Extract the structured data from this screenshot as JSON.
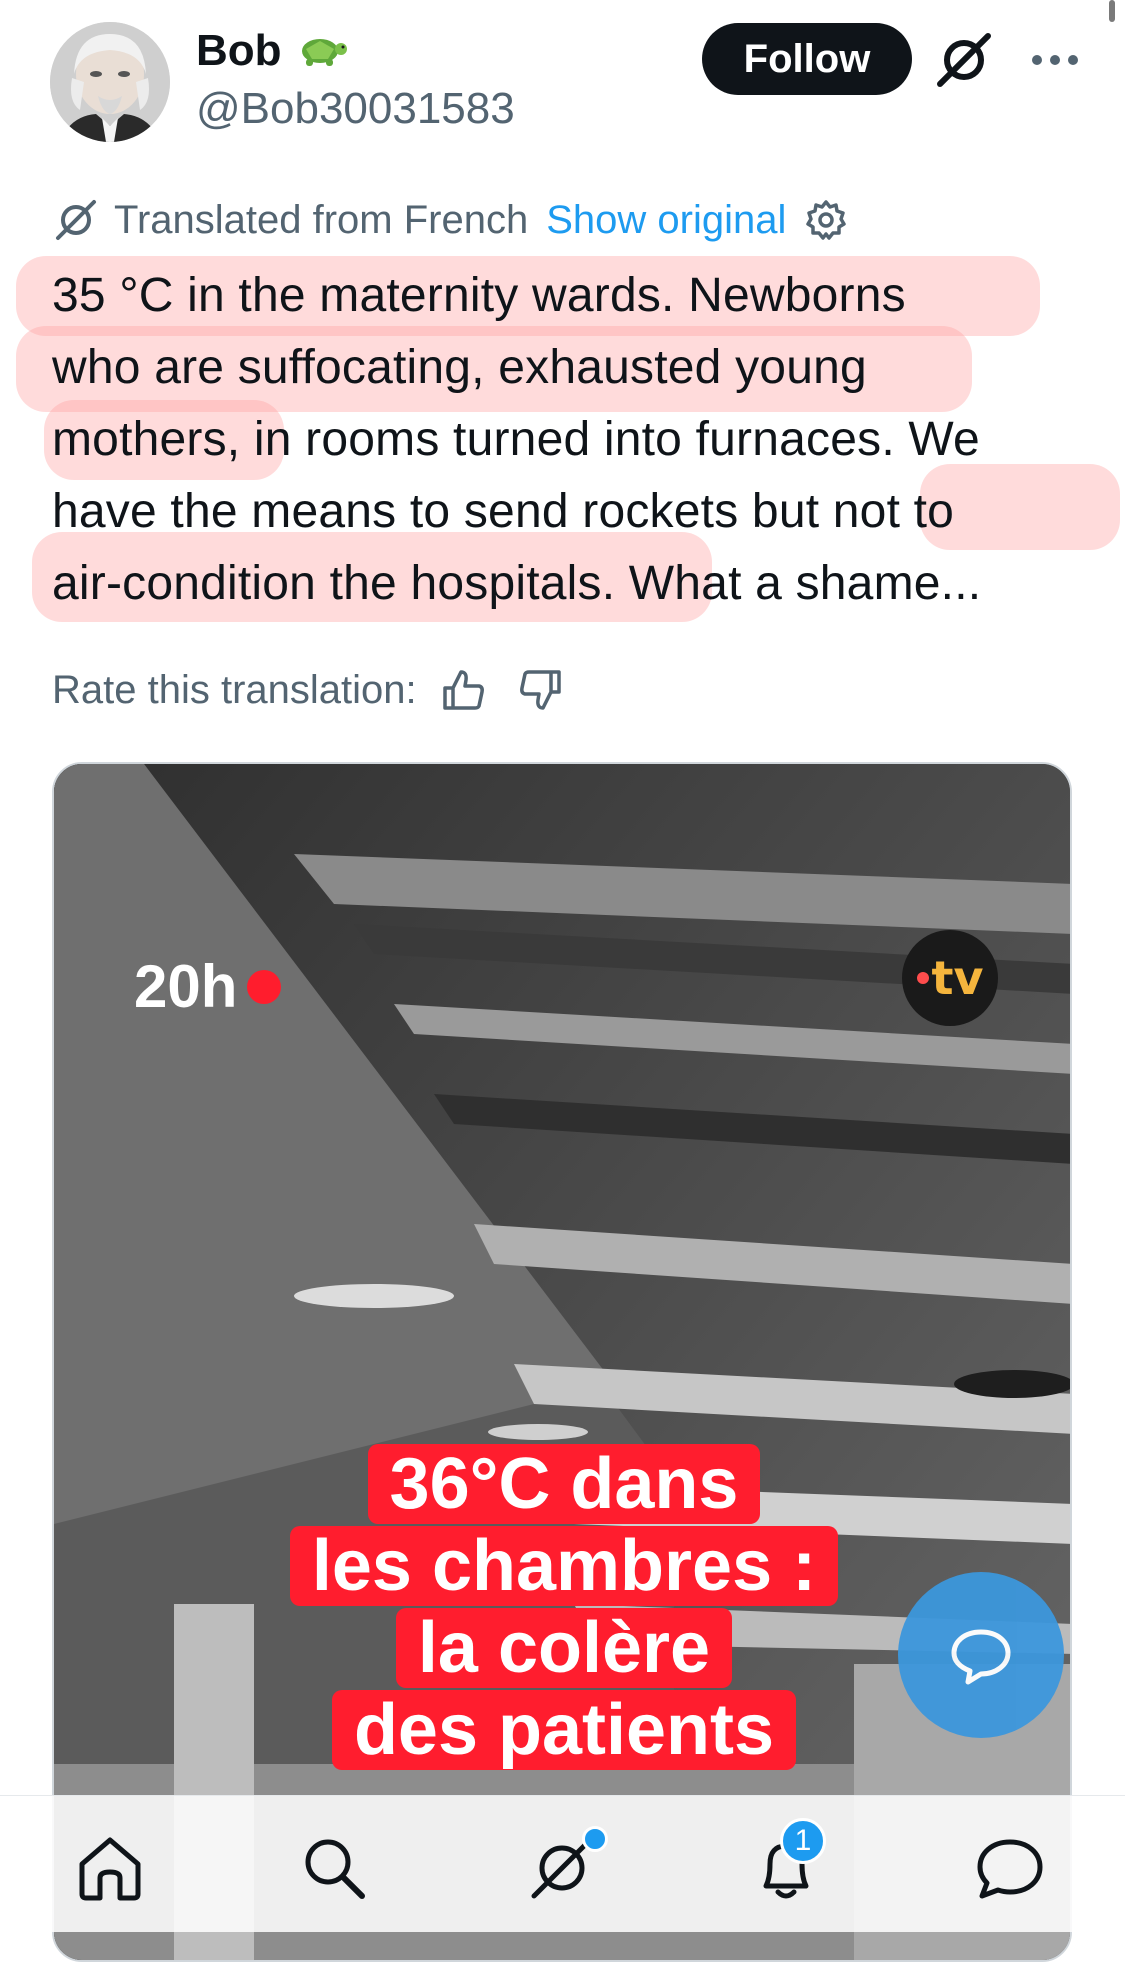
{
  "post": {
    "display_name": "Bob",
    "name_emoji": "turtle",
    "handle": "@Bob30031583",
    "follow_label": "Follow",
    "more_label": "···"
  },
  "translation": {
    "translated_label": "Translated from French",
    "show_original_label": "Show original",
    "rate_label": "Rate this translation:"
  },
  "tweet_text_lines": [
    "35 °C in the maternity wards. Newborns",
    "who are suffocating, exhausted young",
    "mothers, in rooms turned into furnaces. We",
    "have the means to send rockets but not to",
    "air-condition the hospitals. What a shame..."
  ],
  "media": {
    "badge_time": "20h",
    "channel_logo": "tv",
    "caption_lines": [
      "36°C dans",
      "les chambres :",
      "la colère",
      "des patients"
    ]
  },
  "notifications": {
    "count": "1"
  },
  "colors": {
    "accent": "#1d9bf0",
    "highlight": "#ffa0a0",
    "caption_bg": "#ff1d2e",
    "fab": "#3c97dc"
  },
  "icons": [
    "grok-icon",
    "more-icon",
    "gear-icon",
    "thumbs-up-icon",
    "thumbs-down-icon",
    "chat-bubble-icon",
    "home-icon",
    "search-icon",
    "bell-icon",
    "messages-icon"
  ]
}
